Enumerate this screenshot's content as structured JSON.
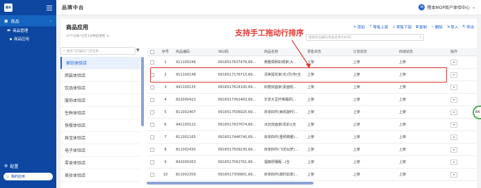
{
  "sidebar": {
    "logo_text": "橙本",
    "groups": [
      {
        "label": "商品"
      },
      {
        "label": "商品管理"
      },
      {
        "label": "商品应用"
      }
    ],
    "settings_label": "配置",
    "search_label": "我的应用"
  },
  "header": {
    "title": "品牌中台",
    "avatar_letter": "M",
    "user_label": "橙本MOP商户体验中心"
  },
  "page": {
    "title": "商品应用",
    "subtitle": "37个记录•已在1分钟前更新",
    "toolbar": {
      "add": "添加",
      "bulk_on": "零售上架",
      "bulk_off": "零售下架",
      "copy": "复制",
      "delete": "删除",
      "import": "导入",
      "export": "导出"
    },
    "table_search_placeholder": "搜索商品编码/商品名称/SKU码",
    "store_search_placeholder": "搜索门店编码/门店名称"
  },
  "annotation": "支持手工拖动行排序",
  "stores": [
    "家纺体验店",
    "西装体验店",
    "饮品体验店",
    "服饰体验店",
    "生鲜体验店",
    "快餐体验店",
    "珠宝体验店",
    "电子体验店",
    "零食体验店",
    "美妆体验店"
  ],
  "table": {
    "headers": {
      "seq": "序号",
      "code": "商品编码",
      "sku": "SKU码",
      "name": "商品名称",
      "retail_status": "零售状态",
      "order_status": "订货状态",
      "mall_status": "商城状态",
      "op": "操作"
    },
    "rows": [
      {
        "seq": "1",
        "code": "911100246",
        "sku": "6916517637476,69...",
        "name": "奥雅侯刷彩绸家(大..",
        "rs": "上架",
        "os": "上架",
        "ms": "上架"
      },
      {
        "seq": "2",
        "code": "911100148",
        "sku": "6916517176715,69...",
        "name": "清爽提花家(长)牙(传(全",
        "rs": "上架",
        "os": "上架",
        "ms": "上架"
      },
      {
        "seq": "3",
        "code": "941100135",
        "sku": "6916517624100,69...",
        "name": "织磨双面家(素面枕...",
        "rs": "上架",
        "os": "上架",
        "ms": "上架"
      },
      {
        "seq": "4",
        "code": "822000423",
        "sku": "6916517361463,69...",
        "name": "乐享大豆纤维蘸研(...",
        "rs": "上架",
        "os": "上架",
        "ms": "上架"
      },
      {
        "seq": "5",
        "code": "811002407",
        "sku": "6916517506925,69...",
        "name": "床单四件(美凯旋时)...",
        "rs": "上架",
        "os": "上架",
        "ms": "上架"
      },
      {
        "seq": "6",
        "code": "941100122",
        "sku": "6916517637674,69...",
        "name": "冰丝双面家(抗彩)(全",
        "rs": "上架",
        "os": "上架",
        "ms": "上架"
      },
      {
        "seq": "7",
        "code": "811001165",
        "sku": "6916517446740,69...",
        "name": "床单四件(重倾典雅)...",
        "rs": "上架",
        "os": "上架",
        "ms": "上架"
      },
      {
        "seq": "8",
        "code": "811002430",
        "sku": "6916517509230,69...",
        "name": "床单四件(飞花似梦)...",
        "rs": "上架",
        "os": "上架",
        "ms": "上架"
      },
      {
        "seq": "9",
        "code": "842000263",
        "sku": "6916517562761,69...",
        "name": "福静舒睡眠...(全",
        "rs": "上架",
        "os": "上架",
        "ms": "上架"
      },
      {
        "seq": "10",
        "code": "811002359",
        "sku": "6916517356801,69...",
        "name": "床单四件(典时如意)...",
        "rs": "上架",
        "os": "上架",
        "ms": "上架"
      }
    ]
  },
  "float_badge": "84",
  "colors": {
    "sidebar_bg": "#0d47a1",
    "accent": "#1a5fd6",
    "annotation": "#e53935"
  }
}
